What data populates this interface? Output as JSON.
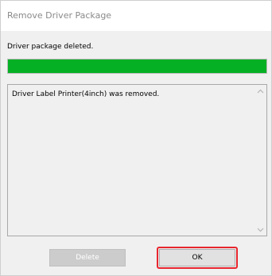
{
  "window": {
    "title": "Remove Driver Package"
  },
  "status": {
    "message": "Driver package deleted."
  },
  "progress": {
    "percent": 100,
    "color": "#06b025"
  },
  "log": {
    "lines": [
      "Driver Label Printer(4inch) was removed."
    ]
  },
  "buttons": {
    "delete_label": "Delete",
    "delete_enabled": false,
    "ok_label": "OK"
  },
  "annotation": {
    "highlight_color": "#e8262e",
    "highlight_target": "ok-button"
  }
}
